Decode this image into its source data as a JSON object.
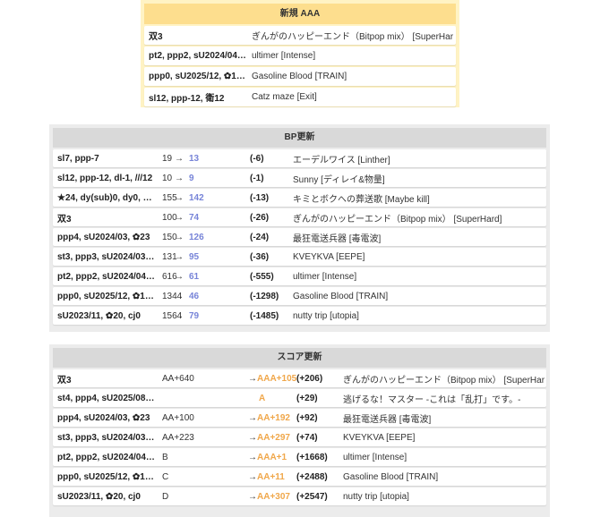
{
  "new_section": {
    "title": "新規 AAA",
    "rows": [
      {
        "name": "双3",
        "song": "ぎんがのハッピーエンド（Bitpop mix） [SuperHard]"
      },
      {
        "name": "pt2, ppp2, sU2024/04…",
        "song": "ultimer [Intense]"
      },
      {
        "name": "ppp0, sU2025/12, ✿1…",
        "song": "Gasoline Blood [TRAIN]"
      },
      {
        "name": "sl12, ppp-12, 衛12",
        "song": "Catz maze [Exit]"
      }
    ]
  },
  "bp_section": {
    "title": "BP更新",
    "rows": [
      {
        "name": "sl7, ppp-7",
        "from": "19",
        "arrow": "→",
        "to": "13",
        "delta": "(-6)",
        "song": "エーデルワイス [Linther]"
      },
      {
        "name": "sl12, ppp-12, dl-1, ///12",
        "from": "10",
        "arrow": "→",
        "to": "9",
        "delta": "(-1)",
        "song": "Sunny [ディレイ&物量]"
      },
      {
        "name": "★24, dy(sub)0, dy0, …",
        "from": "155",
        "arrow": "→",
        "to": "142",
        "delta": "(-13)",
        "song": "キミとボクへの葬送歌 [Maybe kill]"
      },
      {
        "name": "双3",
        "from": "100",
        "arrow": "→",
        "to": "74",
        "delta": "(-26)",
        "song": "ぎんがのハッピーエンド（Bitpop mix） [SuperHard]"
      },
      {
        "name": "ppp4, sU2024/03, ✿23",
        "from": "150",
        "arrow": "→",
        "to": "126",
        "delta": "(-24)",
        "song": "最狂電送兵器 [毒電波]"
      },
      {
        "name": "st3, ppp3, sU2024/03…",
        "from": "131",
        "arrow": "→",
        "to": "95",
        "delta": "(-36)",
        "song": "KVEYKVA [EEPE]"
      },
      {
        "name": "pt2, ppp2, sU2024/04…",
        "from": "616",
        "arrow": "→",
        "to": "61",
        "delta": "(-555)",
        "song": "ultimer [Intense]"
      },
      {
        "name": "ppp0, sU2025/12, ✿1…",
        "from": "1344",
        "arrow": "→",
        "to": "46",
        "delta": "(-1298)",
        "song": "Gasoline Blood [TRAIN]"
      },
      {
        "name": "sU2023/11, ✿20, cj0",
        "from": "1564",
        "arrow": "→",
        "to": "79",
        "delta": "(-1485)",
        "song": "nutty trip [utopia]"
      }
    ]
  },
  "score_section": {
    "title": "スコア更新",
    "rows": [
      {
        "name": "双3",
        "from": "AA+640",
        "arrow": "→",
        "to": "AAA+105",
        "delta": "(+206)",
        "song": "ぎんがのハッピーエンド（Bitpop mix） [SuperHard]"
      },
      {
        "name": "st4, ppp4, sU2025/08…",
        "from": "",
        "arrow": "",
        "to": "A",
        "delta": "(+29)",
        "song": "逃げるな！マスター -これは「乱打」です。-"
      },
      {
        "name": "ppp4, sU2024/03, ✿23",
        "from": "AA+100",
        "arrow": "→",
        "to": "AA+192",
        "delta": "(+92)",
        "song": "最狂電送兵器 [毒電波]"
      },
      {
        "name": "st3, ppp3, sU2024/03…",
        "from": "AA+223",
        "arrow": "→",
        "to": "AA+297",
        "delta": "(+74)",
        "song": "KVEYKVA [EEPE]"
      },
      {
        "name": "pt2, ppp2, sU2024/04…",
        "from": "B",
        "arrow": "→",
        "to": "AAA+1",
        "delta": "(+1668)",
        "song": "ultimer [Intense]"
      },
      {
        "name": "ppp0, sU2025/12, ✿1…",
        "from": "C",
        "arrow": "→",
        "to": "AA+11",
        "delta": "(+2488)",
        "song": "Gasoline Blood [TRAIN]"
      },
      {
        "name": "sU2023/11, ✿20, cj0",
        "from": "D",
        "arrow": "→",
        "to": "AA+307",
        "delta": "(+2547)",
        "song": "nutty trip [utopia]"
      }
    ]
  },
  "colors": {
    "accent_blue": "#7784d8",
    "accent_orange": "#f0a74a",
    "panel_yellow": "#fff3c4",
    "header_yellow": "#fdde8e",
    "panel_gray": "#ececec",
    "header_gray": "#d9d9d9"
  }
}
